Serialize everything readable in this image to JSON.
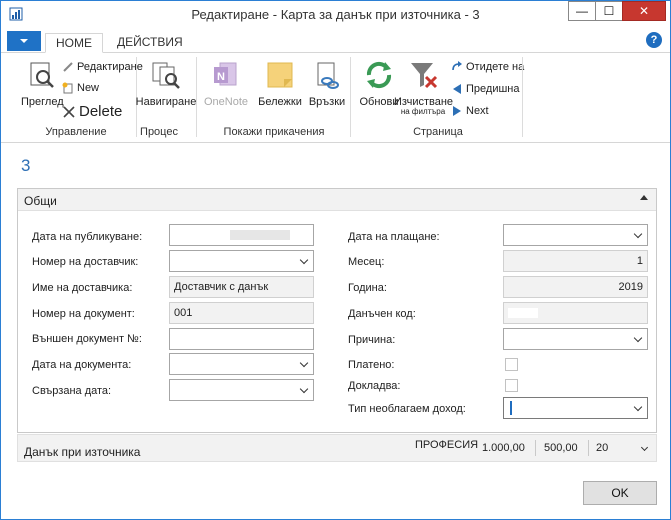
{
  "window": {
    "title": "Редактиране - Карта за данък при източника - 3",
    "minimize": "—",
    "maximize": "☐",
    "close": "✕"
  },
  "tabs": [
    {
      "label": "HOME",
      "active": true
    },
    {
      "label": "ДЕЙСТВИЯ",
      "active": false
    }
  ],
  "help": "?",
  "ribbon": {
    "groups": {
      "manage": "Управление",
      "process": "Процес",
      "attachments": "Покажи прикачения",
      "page": "Страница"
    },
    "view": "Преглед",
    "edit": "Редактиране",
    "new": "New",
    "delete": "Delete",
    "navigate": "Навигиране",
    "onenote": "OneNote",
    "notes": "Бележки",
    "links": "Връзки",
    "refresh": "Обнови",
    "clear_filter_1": "Изчистване",
    "clear_filter_2": "на филтъра",
    "go_to": "Отидете на",
    "previous": "Предишна",
    "next": "Next"
  },
  "record_no": "3",
  "general": {
    "title": "Общи",
    "left": [
      {
        "label": "Дата на публикуване:",
        "value": ""
      },
      {
        "label": "Номер на доставчик:",
        "value": ""
      },
      {
        "label": "Име на доставчика:",
        "value": "Доставчик с данък"
      },
      {
        "label": "Номер на документ:",
        "value": "001"
      },
      {
        "label": "Външен документ №:",
        "value": ""
      },
      {
        "label": "Дата на документа:",
        "value": ""
      },
      {
        "label": "Свързана дата:",
        "value": ""
      }
    ],
    "right": [
      {
        "label": "Дата на плащане:",
        "value": ""
      },
      {
        "label": "Месец:",
        "value": "1"
      },
      {
        "label": "Година:",
        "value": "2019"
      },
      {
        "label": "Данъчен код:",
        "value": ""
      },
      {
        "label": "Причина:",
        "value": ""
      },
      {
        "label": "Платено:",
        "checked": false
      },
      {
        "label": "Докладва:",
        "checked": false
      },
      {
        "label": "Тип необлагаем доход:",
        "value": ""
      }
    ]
  },
  "withholding": {
    "title": "Данък при източника",
    "profession": "ПРОФЕСИЯ",
    "amount": "1.000,00",
    "amount2": "500,00",
    "pct": "20"
  },
  "ok_label": "OK",
  "colors": {
    "accent": "#1f72c6",
    "close": "#c7372f",
    "record_no": "#2d6fb5"
  }
}
